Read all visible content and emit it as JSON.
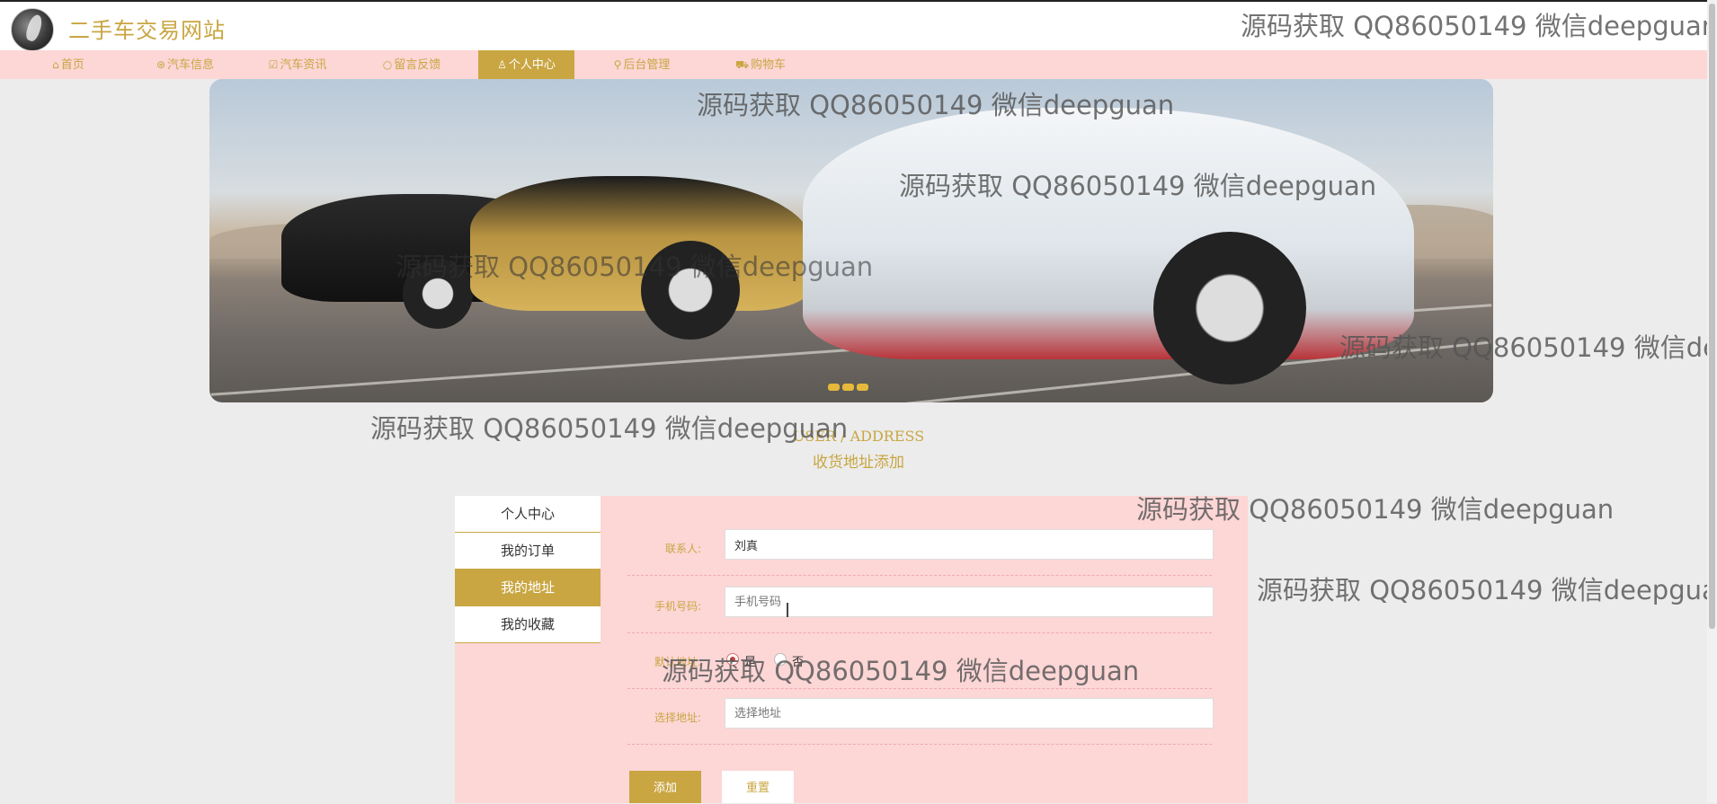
{
  "site": {
    "title": "二手车交易网站"
  },
  "nav": [
    {
      "label": "首页",
      "icon": "⌂"
    },
    {
      "label": "汽车信息",
      "icon": "⊛"
    },
    {
      "label": "汽车资讯",
      "icon": "☑"
    },
    {
      "label": "留言反馈",
      "icon": "○"
    },
    {
      "label": "个人中心",
      "icon": "♙"
    },
    {
      "label": "后台管理",
      "icon": "⚲"
    },
    {
      "label": "购物车",
      "icon": "⛟"
    }
  ],
  "section": {
    "en": "USER / ADDRESS",
    "cn": "收货地址添加"
  },
  "sidebar": [
    "个人中心",
    "我的订单",
    "我的地址",
    "我的收藏"
  ],
  "form": {
    "contact_label": "联系人:",
    "contact_value": "刘真",
    "phone_label": "手机号码:",
    "phone_placeholder": "手机号码",
    "default_label": "默认地址:",
    "yes": "是",
    "no": "否",
    "address_label": "选择地址:",
    "address_placeholder": "选择地址",
    "add_button": "添加",
    "reset_button": "重置"
  },
  "watermark": "源码获取 QQ86050149 微信deepguan",
  "colors": {
    "accent": "#c9a642",
    "pink": "#fdd6d6"
  }
}
